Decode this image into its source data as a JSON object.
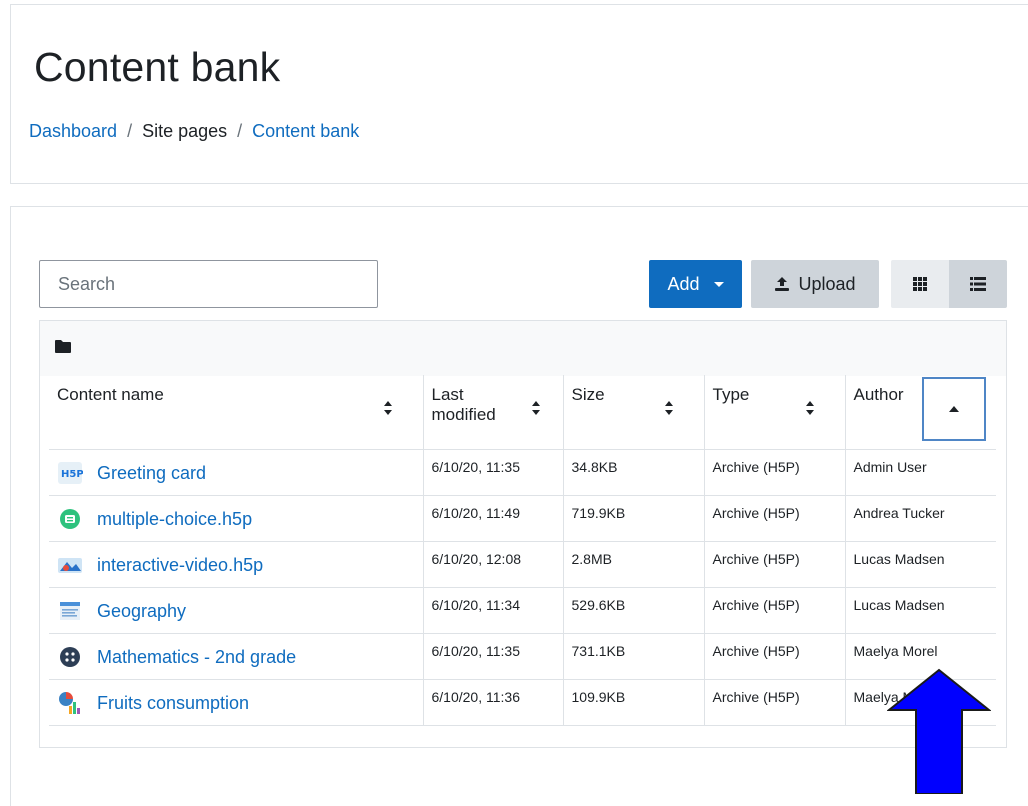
{
  "header": {
    "title": "Content bank",
    "breadcrumb": [
      "Dashboard",
      "Site pages",
      "Content bank"
    ],
    "breadcrumb_separator": "/"
  },
  "toolbar": {
    "search_placeholder": "Search",
    "add_label": "Add",
    "upload_label": "Upload"
  },
  "table": {
    "columns": [
      "Content name",
      "Last modified",
      "Size",
      "Type",
      "Author"
    ],
    "column_last_modified_line1": "Last",
    "column_last_modified_line2": "modified",
    "rows": [
      {
        "name": "Greeting card",
        "icon": "h5p-icon",
        "modified": "6/10/20, 11:35",
        "size": "34.8KB",
        "type": "Archive (H5P)",
        "author": "Admin User"
      },
      {
        "name": "multiple-choice.h5p",
        "icon": "multiple-choice-icon",
        "modified": "6/10/20, 11:49",
        "size": "719.9KB",
        "type": "Archive (H5P)",
        "author": "Andrea Tucker"
      },
      {
        "name": "interactive-video.h5p",
        "icon": "interactive-video-icon",
        "modified": "6/10/20, 12:08",
        "size": "2.8MB",
        "type": "Archive (H5P)",
        "author": "Lucas Madsen"
      },
      {
        "name": "Geography",
        "icon": "document-icon",
        "modified": "6/10/20, 11:34",
        "size": "529.6KB",
        "type": "Archive (H5P)",
        "author": "Lucas Madsen"
      },
      {
        "name": "Mathematics - 2nd grade",
        "icon": "dice-icon",
        "modified": "6/10/20, 11:35",
        "size": "731.1KB",
        "type": "Archive (H5P)",
        "author": "Maelya Morel"
      },
      {
        "name": "Fruits consumption",
        "icon": "chart-icon",
        "modified": "6/10/20, 11:36",
        "size": "109.9KB",
        "type": "Archive (H5P)",
        "author": "Maelya Morel"
      }
    ]
  },
  "colors": {
    "link": "#0f6cbf",
    "primary_button": "#0f6cbf",
    "secondary_button": "#ced4da",
    "annotation_arrow": "#0000ff"
  }
}
